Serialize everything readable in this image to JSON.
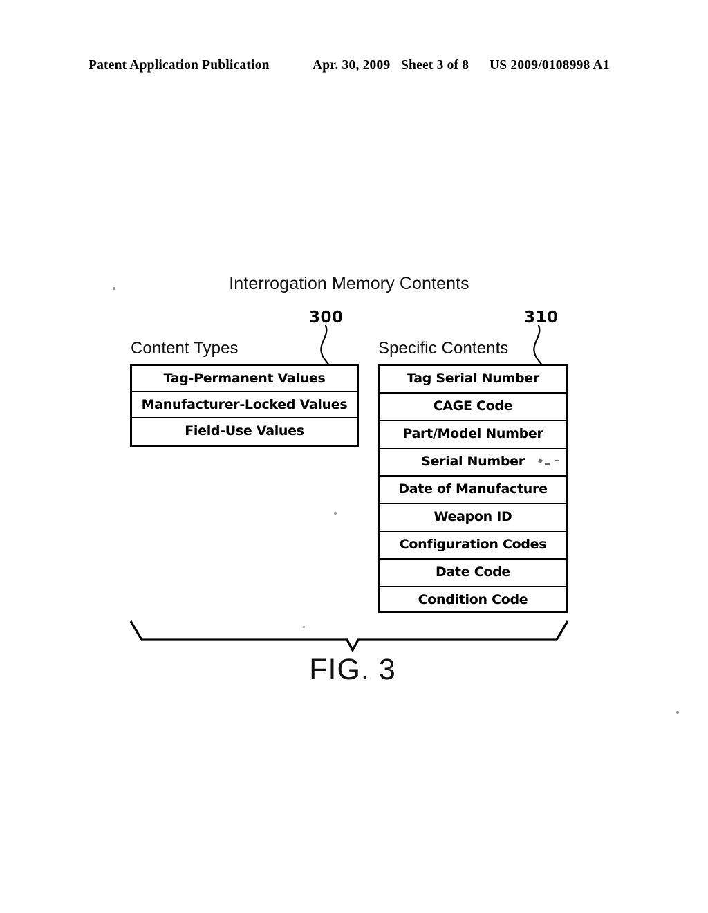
{
  "header": {
    "publication": "Patent Application Publication",
    "date": "Apr. 30, 2009",
    "sheet": "Sheet 3 of 8",
    "patent_number": "US 2009/0108998 A1"
  },
  "figure": {
    "title": "Interrogation Memory Contents",
    "caption": "FIG. 3",
    "columns": [
      {
        "heading": "Content Types",
        "reference_numeral": "300",
        "rows": [
          "Tag-Permanent Values",
          "Manufacturer-Locked Values",
          "Field-Use Values"
        ]
      },
      {
        "heading": "Specific Contents",
        "reference_numeral": "310",
        "rows": [
          "Tag Serial Number",
          "CAGE Code",
          "Part/Model Number",
          "Serial Number",
          "Date of Manufacture",
          "Weapon ID",
          "Configuration Codes",
          "Date Code",
          "Condition Code"
        ]
      }
    ]
  },
  "colors": {
    "ink": "#000000",
    "page": "#ffffff"
  }
}
